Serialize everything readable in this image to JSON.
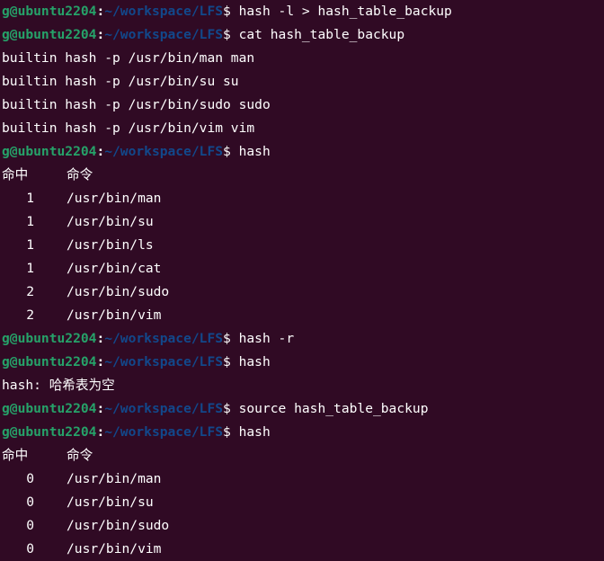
{
  "prompt": {
    "user_host": "g@ubuntu2204",
    "colon": ":",
    "path": "~/workspace/LFS",
    "dollar": "$ "
  },
  "lines": [
    {
      "type": "cmd",
      "text": "hash -l > hash_table_backup"
    },
    {
      "type": "cmd",
      "text": "cat hash_table_backup"
    },
    {
      "type": "out",
      "text": "builtin hash -p /usr/bin/man man"
    },
    {
      "type": "out",
      "text": "builtin hash -p /usr/bin/su su"
    },
    {
      "type": "out",
      "text": "builtin hash -p /usr/bin/sudo sudo"
    },
    {
      "type": "out",
      "text": "builtin hash -p /usr/bin/vim vim"
    },
    {
      "type": "cmd",
      "text": "hash"
    },
    {
      "type": "header",
      "hits": "命中",
      "cmd": "命令"
    },
    {
      "type": "row",
      "hits": "1",
      "path": "/usr/bin/man"
    },
    {
      "type": "row",
      "hits": "1",
      "path": "/usr/bin/su"
    },
    {
      "type": "row",
      "hits": "1",
      "path": "/usr/bin/ls"
    },
    {
      "type": "row",
      "hits": "1",
      "path": "/usr/bin/cat"
    },
    {
      "type": "row",
      "hits": "2",
      "path": "/usr/bin/sudo"
    },
    {
      "type": "row",
      "hits": "2",
      "path": "/usr/bin/vim"
    },
    {
      "type": "cmd",
      "text": "hash -r"
    },
    {
      "type": "cmd",
      "text": "hash"
    },
    {
      "type": "out",
      "text": "hash: 哈希表为空"
    },
    {
      "type": "cmd",
      "text": "source hash_table_backup"
    },
    {
      "type": "cmd",
      "text": "hash"
    },
    {
      "type": "header",
      "hits": "命中",
      "cmd": "命令"
    },
    {
      "type": "row",
      "hits": "0",
      "path": "/usr/bin/man"
    },
    {
      "type": "row",
      "hits": "0",
      "path": "/usr/bin/su"
    },
    {
      "type": "row",
      "hits": "0",
      "path": "/usr/bin/sudo"
    },
    {
      "type": "row",
      "hits": "0",
      "path": "/usr/bin/vim"
    }
  ]
}
